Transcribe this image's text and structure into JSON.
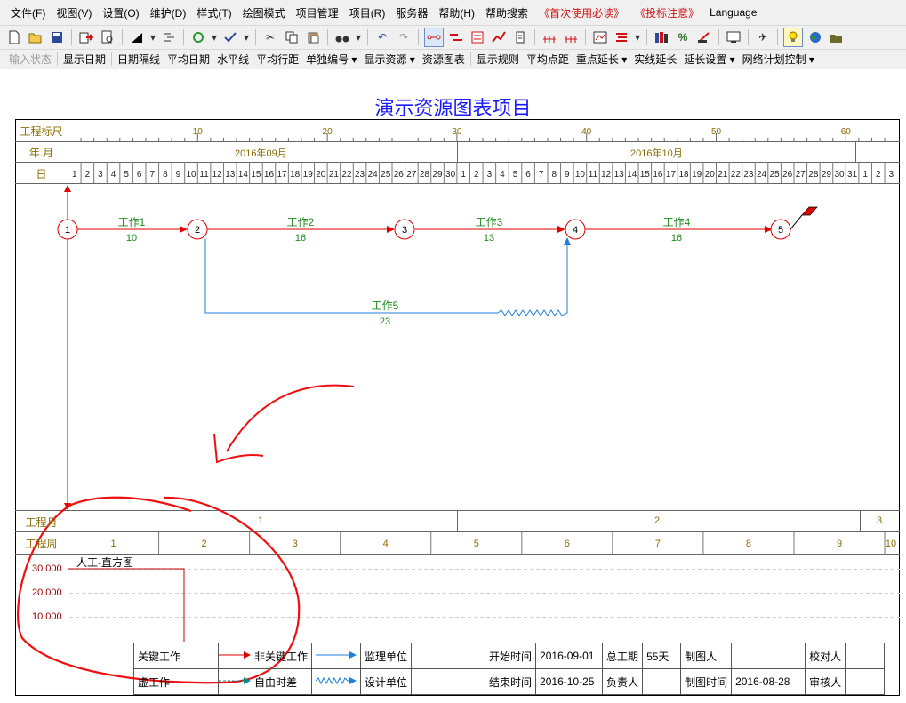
{
  "menu": [
    "文件(F)",
    "视图(V)",
    "设置(O)",
    "维护(D)",
    "样式(T)",
    "绘图模式",
    "项目管理",
    "项目(R)",
    "服务器",
    "帮助(H)",
    "帮助搜索",
    "《首次使用必读》",
    "《投标注意》",
    "Language"
  ],
  "toolbar2": [
    "输入状态",
    "显示日期",
    "日期隔线",
    "平均日期",
    "水平线",
    "平均行距",
    "单独编号 ▾",
    "显示资源 ▾",
    "资源图表",
    "显示规则",
    "平均点距",
    "重点延长 ▾",
    "实线延长",
    "延长设置 ▾",
    "网络计划控制 ▾"
  ],
  "chart": {
    "title": "演示资源图表项目",
    "rows": {
      "ruler": "工程标尺",
      "yearmonth": "年.月",
      "day": "日",
      "month": "工程月",
      "week": "工程周"
    },
    "ruler_ticks": [
      "10",
      "20",
      "30",
      "40",
      "50",
      "60"
    ],
    "months": [
      "2016年09月",
      "2016年10月"
    ],
    "days_sep": [
      "1",
      "2",
      "3",
      "4",
      "5",
      "6",
      "7",
      "8",
      "9",
      "10",
      "11",
      "12",
      "13",
      "14",
      "15",
      "16",
      "17",
      "18",
      "19",
      "20",
      "21",
      "22",
      "23",
      "24",
      "25",
      "26",
      "27",
      "28",
      "29",
      "30"
    ],
    "days_oct": [
      "1",
      "2",
      "3",
      "4",
      "5",
      "6",
      "7",
      "8",
      "9",
      "10",
      "11",
      "12",
      "13",
      "14",
      "15",
      "16",
      "17",
      "18",
      "19",
      "20",
      "21",
      "22",
      "23",
      "24",
      "25",
      "26",
      "27",
      "28",
      "29",
      "30",
      "31"
    ],
    "days_nov": [
      "1",
      "2",
      "3"
    ],
    "project_months": [
      "1",
      "2",
      "3"
    ],
    "project_weeks": [
      "1",
      "2",
      "3",
      "4",
      "5",
      "6",
      "7",
      "8",
      "9",
      "10"
    ],
    "nodes": [
      "1",
      "2",
      "3",
      "4",
      "5"
    ],
    "works": [
      {
        "name": "工作1",
        "duration": "10"
      },
      {
        "name": "工作2",
        "duration": "16"
      },
      {
        "name": "工作3",
        "duration": "13"
      },
      {
        "name": "工作4",
        "duration": "16"
      },
      {
        "name": "工作5",
        "duration": "23"
      }
    ],
    "histogram": {
      "title": "人工-直方图",
      "y_ticks": [
        "30.000",
        "20.000",
        "10.000"
      ]
    }
  },
  "legend": {
    "critical": "关键工作",
    "noncritical": "非关键工作",
    "virtual": "虚工作",
    "float": "自由时差",
    "supervisor": "监理单位",
    "designer": "设计单位",
    "start_label": "开始时间",
    "start_value": "2016-09-01",
    "end_label": "结束时间",
    "end_value": "2016-10-25",
    "duration_label": "总工期",
    "duration_value": "55天",
    "owner_label": "负责人",
    "drawer_label": "制图人",
    "drawtime_label": "制图时间",
    "drawtime_value": "2016-08-28",
    "checker_label": "校对人",
    "reviewer_label": "审核人"
  },
  "colors": {
    "critical": "#e00000",
    "noncritical": "#1f7fd6",
    "title": "#1a1aff",
    "scale_text": "#8a6d00"
  }
}
